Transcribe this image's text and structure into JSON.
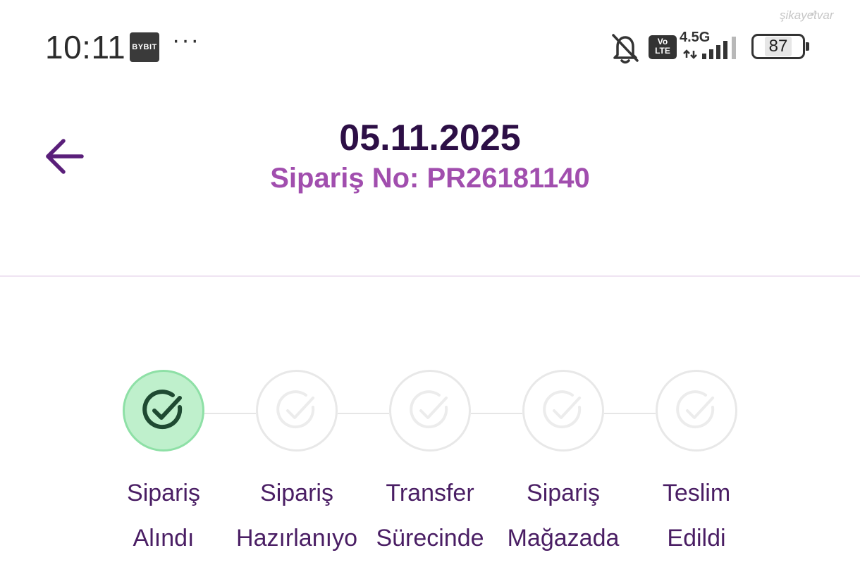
{
  "status_bar": {
    "time": "10:11",
    "app_badge": "BYBIT",
    "more": "···",
    "volte_top": "Vo",
    "volte_bottom": "LTE",
    "network": "4.5G",
    "battery": "87",
    "watermark": "şikayetvar"
  },
  "header": {
    "date": "05.11.2025",
    "order_number": "Sipariş No: PR26181140"
  },
  "stepper": {
    "steps": [
      {
        "line1": "Sipariş",
        "line2": "Alındı",
        "done": true
      },
      {
        "line1": "Sipariş",
        "line2": "Hazırlanıyo",
        "done": false
      },
      {
        "line1": "Transfer",
        "line2": "Sürecinde",
        "done": false
      },
      {
        "line1": "Sipariş",
        "line2": "Mağazada",
        "done": false
      },
      {
        "line1": "Teslim",
        "line2": "Edildi",
        "done": false
      }
    ]
  },
  "colors": {
    "title": "#2d0f46",
    "order_number": "#a14eae",
    "step_label": "#4a1e64",
    "step_done_fill": "#bff0cc",
    "step_done_border": "#8ee0a6",
    "step_done_check": "#1f4a32",
    "step_pending_border": "#e8e8e8",
    "back_arrow": "#5a1f7a"
  },
  "icons": {
    "back": "arrow-left-icon",
    "step_check": "check-circle-icon",
    "bell": "bell-off-icon",
    "signal": "signal-icon"
  }
}
